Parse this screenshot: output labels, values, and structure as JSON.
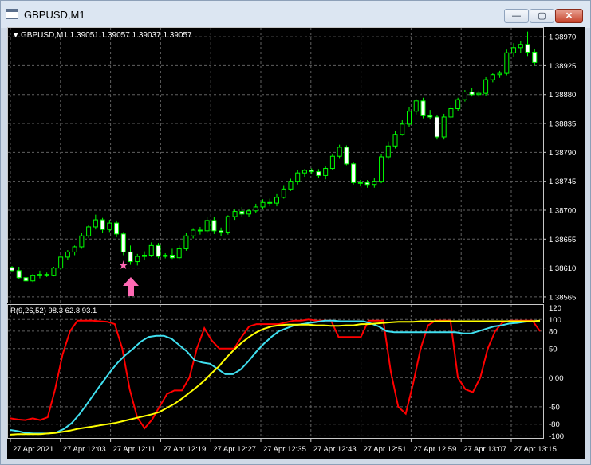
{
  "window": {
    "title": "GBPUSD,M1",
    "buttons": {
      "minimize": "—",
      "maximize": "▢",
      "close": "✕"
    }
  },
  "chart": {
    "header": "GBPUSD,M1  1.39051 1.39057 1.39037 1.39057",
    "price_labels": [
      "1.38970",
      "1.38925",
      "1.38880",
      "1.38835",
      "1.38790",
      "1.38745",
      "1.38700",
      "1.38655",
      "1.38610",
      "1.38565"
    ],
    "time_labels": [
      "27 Apr 2021",
      "27 Apr 12:03",
      "27 Apr 12:11",
      "27 Apr 12:19",
      "27 Apr 12:27",
      "27 Apr 12:35",
      "27 Apr 12:43",
      "27 Apr 12:51",
      "27 Apr 12:59",
      "27 Apr 13:07",
      "27 Apr 13:15"
    ],
    "indicator_header": "R(9,26,52) 98.3 62.8 93.1",
    "indicator_labels": [
      "120",
      "100",
      "80",
      "50",
      "0.00",
      "-50",
      "-80",
      "-100"
    ],
    "colors": {
      "bull_candle": "#00ff00",
      "bear_candle": "#ffffff",
      "grid": "#606060",
      "red_line": "#ff0000",
      "cyan_line": "#40e0f0",
      "yellow_line": "#ffff00",
      "star": "#ff69b4",
      "arrow": "#ff69b4"
    },
    "markers": {
      "star": "★",
      "arrow": "up-arrow"
    }
  },
  "chart_data": {
    "type": "candlestick",
    "symbol": "GBPUSD",
    "timeframe": "M1",
    "ylim": [
      1.38555,
      1.38985
    ],
    "candles": [
      [
        1.38611,
        1.38613,
        1.38605,
        1.38606
      ],
      [
        1.38606,
        1.38612,
        1.38593,
        1.38595
      ],
      [
        1.38595,
        1.38597,
        1.38588,
        1.3859
      ],
      [
        1.3859,
        1.38601,
        1.38588,
        1.38598
      ],
      [
        1.38598,
        1.38606,
        1.38594,
        1.386
      ],
      [
        1.386,
        1.38603,
        1.38596,
        1.38598
      ],
      [
        1.38598,
        1.38612,
        1.38597,
        1.3861
      ],
      [
        1.3861,
        1.3863,
        1.38607,
        1.38627
      ],
      [
        1.38627,
        1.38638,
        1.38623,
        1.38635
      ],
      [
        1.38635,
        1.38645,
        1.3863,
        1.38643
      ],
      [
        1.38643,
        1.38665,
        1.3864,
        1.3866
      ],
      [
        1.3866,
        1.38677,
        1.38657,
        1.38674
      ],
      [
        1.38674,
        1.38693,
        1.3867,
        1.38685
      ],
      [
        1.38685,
        1.38688,
        1.38665,
        1.3867
      ],
      [
        1.3867,
        1.38685,
        1.38666,
        1.3868
      ],
      [
        1.3868,
        1.38684,
        1.38658,
        1.38663
      ],
      [
        1.38663,
        1.38666,
        1.3863,
        1.38635
      ],
      [
        1.38635,
        1.38645,
        1.38615,
        1.3862
      ],
      [
        1.3862,
        1.38632,
        1.38614,
        1.38628
      ],
      [
        1.38628,
        1.38636,
        1.38622,
        1.3863
      ],
      [
        1.3863,
        1.3865,
        1.38627,
        1.38645
      ],
      [
        1.38645,
        1.38649,
        1.38625,
        1.38628
      ],
      [
        1.38628,
        1.38633,
        1.38625,
        1.3863
      ],
      [
        1.3863,
        1.3864,
        1.38624,
        1.38626
      ],
      [
        1.38626,
        1.38645,
        1.38624,
        1.3864
      ],
      [
        1.3864,
        1.38665,
        1.38637,
        1.3866
      ],
      [
        1.3866,
        1.38672,
        1.38656,
        1.38669
      ],
      [
        1.38669,
        1.38674,
        1.38662,
        1.38668
      ],
      [
        1.38668,
        1.3869,
        1.38664,
        1.38684
      ],
      [
        1.38684,
        1.38689,
        1.38663,
        1.38668
      ],
      [
        1.38668,
        1.38673,
        1.3866,
        1.38666
      ],
      [
        1.38666,
        1.38692,
        1.38662,
        1.3869
      ],
      [
        1.3869,
        1.38701,
        1.38685,
        1.38698
      ],
      [
        1.38698,
        1.38705,
        1.3869,
        1.38694
      ],
      [
        1.38694,
        1.38702,
        1.3869,
        1.38699
      ],
      [
        1.38699,
        1.3871,
        1.38695,
        1.38705
      ],
      [
        1.38705,
        1.38717,
        1.38701,
        1.38712
      ],
      [
        1.38712,
        1.38718,
        1.38706,
        1.38711
      ],
      [
        1.38711,
        1.38725,
        1.38706,
        1.3872
      ],
      [
        1.3872,
        1.38739,
        1.38718,
        1.38733
      ],
      [
        1.38733,
        1.38749,
        1.3873,
        1.38745
      ],
      [
        1.38745,
        1.38762,
        1.3874,
        1.38758
      ],
      [
        1.38758,
        1.38764,
        1.38752,
        1.38762
      ],
      [
        1.38762,
        1.38765,
        1.38756,
        1.3876
      ],
      [
        1.3876,
        1.38764,
        1.3875,
        1.38754
      ],
      [
        1.38754,
        1.38768,
        1.38748,
        1.38765
      ],
      [
        1.38765,
        1.38787,
        1.38762,
        1.38784
      ],
      [
        1.38784,
        1.38802,
        1.3878,
        1.38798
      ],
      [
        1.38798,
        1.38801,
        1.3877,
        1.38772
      ],
      [
        1.38772,
        1.38775,
        1.3874,
        1.38743
      ],
      [
        1.38743,
        1.38747,
        1.38737,
        1.38743
      ],
      [
        1.38743,
        1.38747,
        1.38735,
        1.3874
      ],
      [
        1.3874,
        1.3875,
        1.38735,
        1.38745
      ],
      [
        1.38745,
        1.38787,
        1.38742,
        1.38783
      ],
      [
        1.38783,
        1.38807,
        1.38779,
        1.388
      ],
      [
        1.388,
        1.38823,
        1.38796,
        1.38818
      ],
      [
        1.38818,
        1.3884,
        1.38816,
        1.38834
      ],
      [
        1.38834,
        1.3886,
        1.3883,
        1.38854
      ],
      [
        1.38854,
        1.38873,
        1.38849,
        1.3887
      ],
      [
        1.3887,
        1.38875,
        1.38843,
        1.38847
      ],
      [
        1.38847,
        1.38856,
        1.38841,
        1.38845
      ],
      [
        1.38845,
        1.38848,
        1.3881,
        1.38814
      ],
      [
        1.38814,
        1.3885,
        1.3881,
        1.38845
      ],
      [
        1.38845,
        1.38863,
        1.38842,
        1.38858
      ],
      [
        1.38858,
        1.38875,
        1.38854,
        1.38872
      ],
      [
        1.38872,
        1.38887,
        1.38869,
        1.38884
      ],
      [
        1.38884,
        1.3889,
        1.38877,
        1.3888
      ],
      [
        1.3888,
        1.38886,
        1.38876,
        1.38882
      ],
      [
        1.38882,
        1.38907,
        1.38878,
        1.38903
      ],
      [
        1.38903,
        1.38913,
        1.38899,
        1.38911
      ],
      [
        1.38911,
        1.38917,
        1.38906,
        1.38913
      ],
      [
        1.38913,
        1.3895,
        1.3891,
        1.38945
      ],
      [
        1.38945,
        1.3896,
        1.38938,
        1.38953
      ],
      [
        1.38953,
        1.38963,
        1.38945,
        1.38958
      ],
      [
        1.38958,
        1.38978,
        1.3894,
        1.38946
      ],
      [
        1.38946,
        1.38951,
        1.38925,
        1.3893
      ]
    ],
    "indicator": {
      "name": "R(9,26,52)",
      "ylim": [
        -105,
        125
      ],
      "series": [
        {
          "name": "R9",
          "color": "#ff0000",
          "values": [
            -70,
            -72,
            -73,
            -70,
            -73,
            -68,
            -20,
            40,
            80,
            98,
            98,
            98,
            97,
            96,
            92,
            50,
            -20,
            -68,
            -87,
            -72,
            -50,
            -28,
            -22,
            -22,
            0,
            50,
            85,
            64,
            50,
            50,
            50,
            70,
            88,
            92,
            92,
            92,
            92,
            95,
            98,
            98,
            100,
            98,
            98,
            98,
            70,
            70,
            70,
            70,
            98,
            98,
            98,
            10,
            -50,
            -62,
            -10,
            50,
            90,
            98,
            98,
            98,
            0,
            -20,
            -25,
            0,
            50,
            80,
            95,
            98,
            98,
            98,
            98,
            80
          ]
        },
        {
          "name": "R26",
          "color": "#40e0f0",
          "values": [
            -90,
            -92,
            -95,
            -96,
            -96,
            -96,
            -94,
            -88,
            -78,
            -63,
            -45,
            -26,
            -8,
            10,
            26,
            39,
            50,
            62,
            70,
            72,
            72,
            67,
            56,
            45,
            30,
            26,
            24,
            15,
            6,
            6,
            14,
            28,
            44,
            58,
            70,
            80,
            85,
            90,
            92,
            94,
            96,
            98,
            98,
            97,
            97,
            97,
            97,
            93,
            88,
            80,
            78,
            78,
            78,
            78,
            78,
            78,
            78,
            78,
            78,
            76,
            76,
            80,
            84,
            88,
            90,
            93,
            94,
            96,
            97,
            97
          ]
        },
        {
          "name": "R52",
          "color": "#ffff00",
          "values": [
            -98,
            -97,
            -97,
            -97,
            -97,
            -96,
            -95,
            -93,
            -91,
            -88,
            -86,
            -84,
            -82,
            -80,
            -78,
            -75,
            -72,
            -69,
            -66,
            -63,
            -59,
            -52,
            -45,
            -36,
            -26,
            -16,
            -5,
            8,
            20,
            35,
            48,
            60,
            70,
            78,
            84,
            88,
            90,
            91,
            91,
            91,
            91,
            90,
            90,
            89,
            89,
            90,
            90,
            92,
            92,
            93,
            94,
            95,
            96,
            96,
            96,
            97,
            97,
            97,
            97,
            97,
            97,
            97,
            97,
            97,
            97,
            97,
            97,
            97,
            97,
            97,
            97,
            98
          ]
        }
      ]
    },
    "ylabel": "",
    "xlabel": ""
  }
}
